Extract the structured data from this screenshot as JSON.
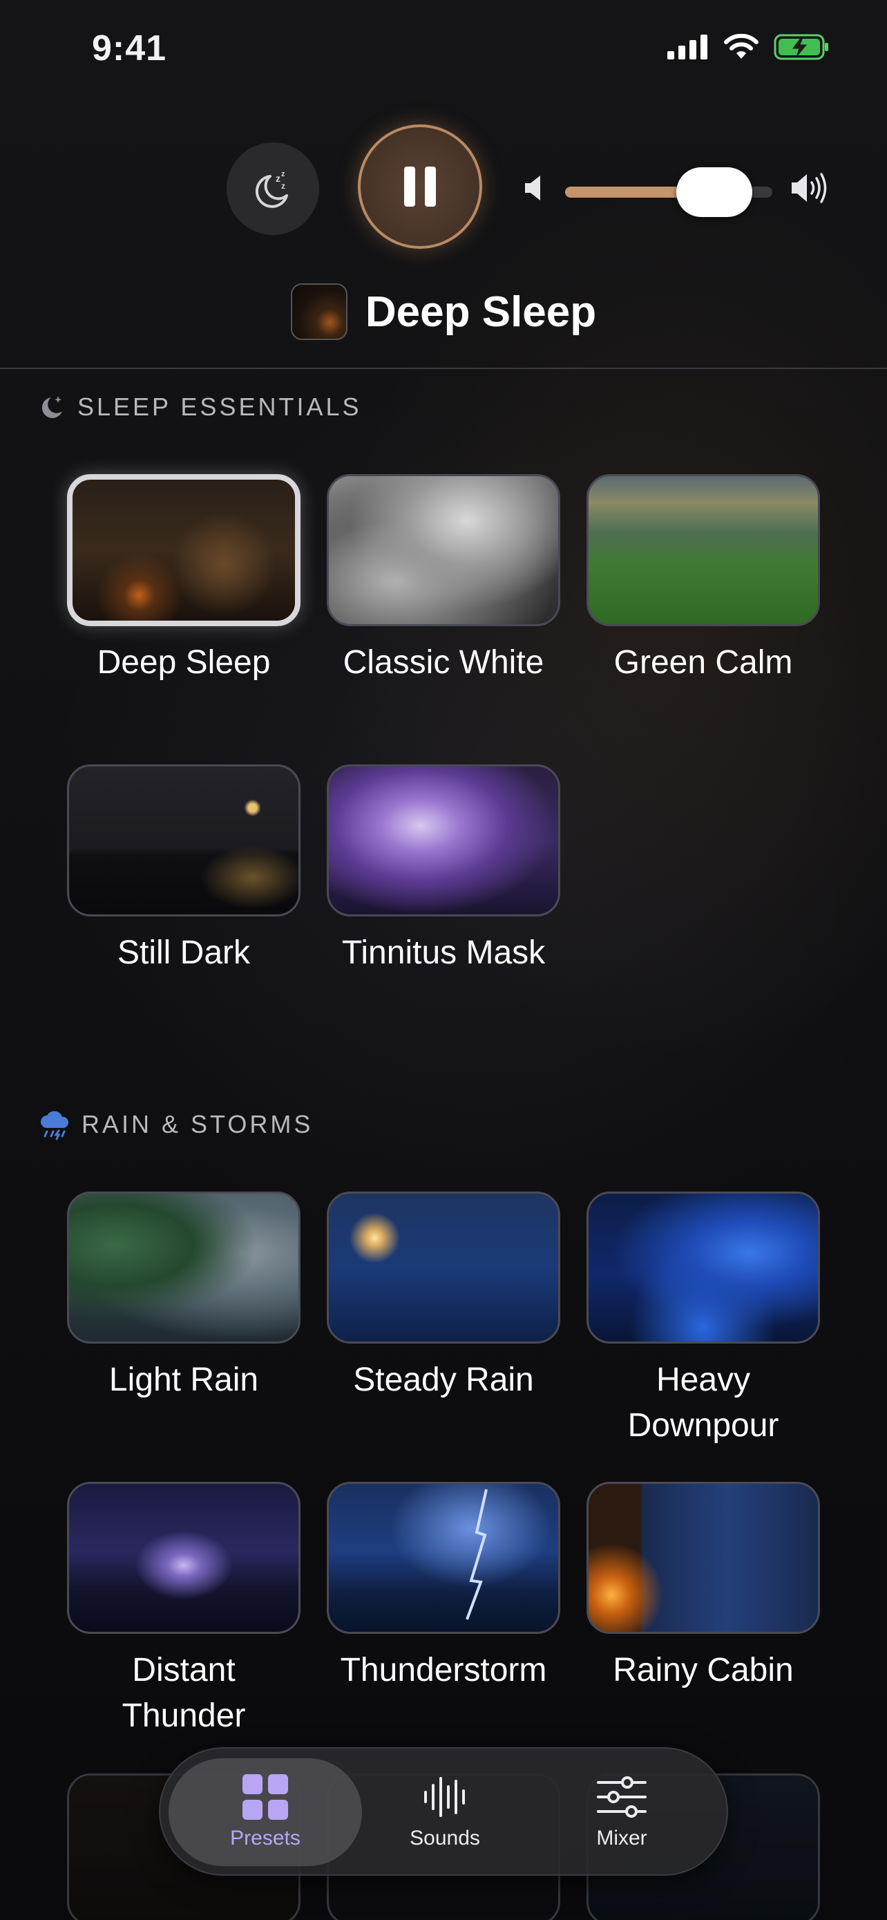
{
  "status_bar": {
    "time": "9:41"
  },
  "player": {
    "now_playing_title": "Deep Sleep",
    "volume": 0.72,
    "accent_color": "#c5946a",
    "icons": {
      "timer": "moon-zzz-icon",
      "pause": "pause-icon",
      "volume_low": "speaker-low-icon",
      "volume_high": "speaker-high-icon"
    }
  },
  "sections": [
    {
      "title": "SLEEP ESSENTIALS",
      "icon": "moon-stars-icon",
      "items": [
        {
          "label": "Deep Sleep",
          "selected": true
        },
        {
          "label": "Classic White"
        },
        {
          "label": "Green Calm"
        },
        {
          "label": "Still Dark"
        },
        {
          "label": "Tinnitus Mask"
        }
      ]
    },
    {
      "title": "RAIN & STORMS",
      "icon": "cloud-rain-icon",
      "items": [
        {
          "label": "Light Rain"
        },
        {
          "label": "Steady Rain"
        },
        {
          "label": "Heavy Downpour"
        },
        {
          "label": "Distant Thunder"
        },
        {
          "label": "Thunderstorm"
        },
        {
          "label": "Rainy Cabin"
        }
      ]
    }
  ],
  "tab_bar": {
    "tabs": [
      {
        "label": "Presets",
        "icon": "grid-icon",
        "active": true
      },
      {
        "label": "Sounds",
        "icon": "waveform-icon"
      },
      {
        "label": "Mixer",
        "icon": "sliders-icon"
      }
    ],
    "active_color": "#b8a6f5"
  }
}
